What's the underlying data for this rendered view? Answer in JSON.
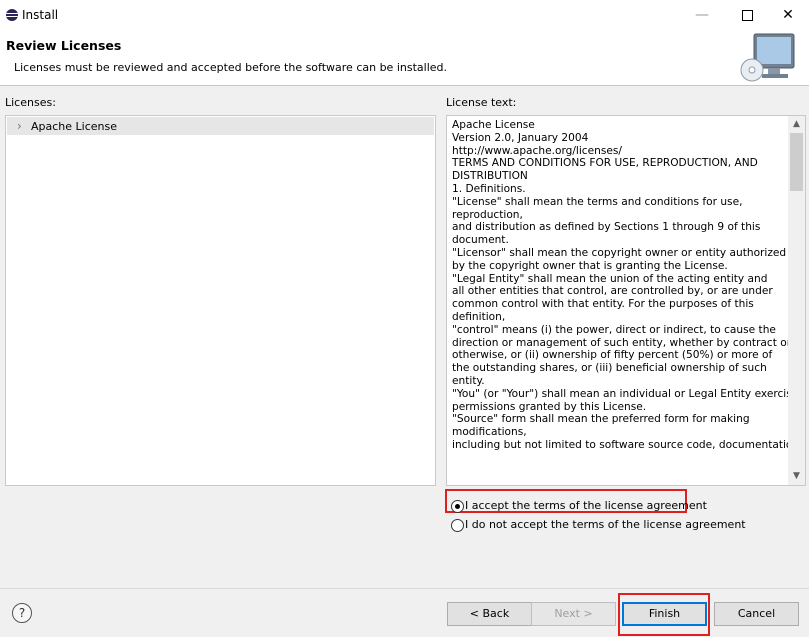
{
  "window": {
    "title": "Install",
    "controls": {
      "minimize": "—",
      "maximize": "",
      "close": "✕"
    }
  },
  "header": {
    "title": "Review Licenses",
    "subtitle": "Licenses must be reviewed and accepted before the software can be installed."
  },
  "licenses_panel": {
    "label": "Licenses:",
    "items": [
      {
        "label": "Apache License",
        "expand_icon": "chevron-right-icon"
      }
    ]
  },
  "license_text_panel": {
    "label": "License text:",
    "lines": [
      "Apache License",
      "Version 2.0, January 2004",
      "http://www.apache.org/licenses/",
      "TERMS AND CONDITIONS FOR USE, REPRODUCTION, AND",
      "DISTRIBUTION",
      "1. Definitions.",
      "\"License\" shall mean the terms and conditions for use,",
      "reproduction,",
      "and distribution as defined by Sections 1 through 9 of this",
      "document.",
      "\"Licensor\" shall mean the copyright owner or entity authorized",
      "by the copyright owner that is granting the License.",
      "\"Legal Entity\" shall mean the union of the acting entity and",
      "all other entities that control, are controlled by, or are under",
      "common control with that entity. For the purposes of this",
      "definition,",
      "\"control\" means (i) the power, direct or indirect, to cause the",
      "direction or management of such entity, whether by contract or",
      "otherwise, or (ii) ownership of fifty percent (50%) or more of",
      "the outstanding shares, or (iii) beneficial ownership of such",
      "entity.",
      "\"You\" (or \"Your\") shall mean an individual or Legal Entity exercising",
      "permissions granted by this License.",
      "\"Source\" form shall mean the preferred form for making",
      "modifications,",
      "including but not limited to software source code, documentation"
    ]
  },
  "agreement": {
    "accept_label": "I accept the terms of the license agreement",
    "decline_label": "I do not accept the terms of the license agreement",
    "selected": "accept"
  },
  "buttons": {
    "back": "< Back",
    "next": "Next >",
    "finish": "Finish",
    "cancel": "Cancel",
    "help": "?"
  },
  "colors": {
    "highlight_border": "#e02020",
    "default_button_border": "#0078d7"
  }
}
